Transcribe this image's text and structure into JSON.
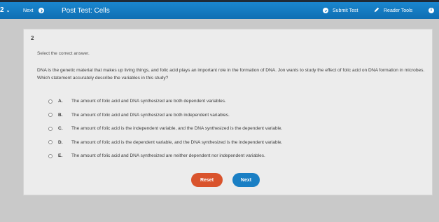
{
  "header": {
    "question_indicator": "2",
    "next_label": "Next",
    "title": "Post Test: Cells",
    "submit_label": "Submit Test",
    "tools_label": "Reader Tools",
    "info_glyph": "i",
    "bar_color": "#1479c0"
  },
  "question": {
    "number": "2",
    "instructions": "Select the correct answer.",
    "stem": "DNA is the genetic material that makes up living things, and folic acid plays an important role in the formation of DNA. Jon wants to study the effect of folic acid on DNA formation in microbes. Which statement accurately describe the variables in this study?",
    "choices": [
      {
        "letter": "A.",
        "text": "The amount of folic acid and DNA synthesized are both dependent variables."
      },
      {
        "letter": "B.",
        "text": "The amount of folic acid and DNA synthesized are both independent variables."
      },
      {
        "letter": "C.",
        "text": "The amount of folic acid is the independent variable, and the DNA synthesized is the dependent variable."
      },
      {
        "letter": "D.",
        "text": "The amount of folic acid is the dependent variable, and the DNA synthesized is the independent variable."
      },
      {
        "letter": "E.",
        "text": "The amount of folic acid and DNA synthesized are neither dependent nor independent variables."
      }
    ]
  },
  "actions": {
    "reset_label": "Reset",
    "next_label": "Next",
    "reset_color": "#d9532c",
    "next_color": "#1a7fc4"
  }
}
